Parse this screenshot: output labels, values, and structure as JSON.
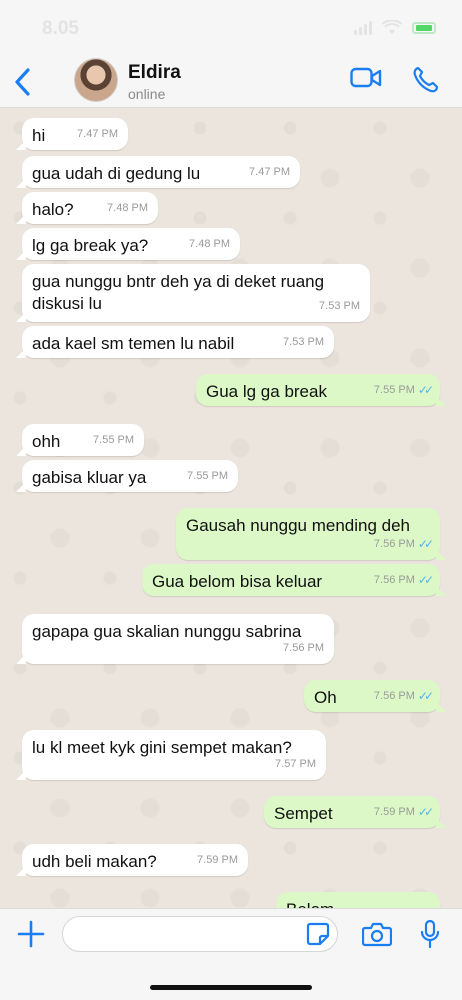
{
  "status_bar": {
    "time": "8.05"
  },
  "header": {
    "name": "Eldira",
    "status": "online"
  },
  "colors": {
    "accent": "#1a7ef2",
    "outgoing_bubble": "#dcf8c6",
    "incoming_bubble": "#ffffff",
    "read_ticks": "#4fb6ec"
  },
  "messages": [
    {
      "dir": "in",
      "text": "hi",
      "time": "7.47 PM"
    },
    {
      "dir": "in",
      "text": "gua udah di gedung lu",
      "time": "7.47 PM"
    },
    {
      "dir": "in",
      "text": "halo?",
      "time": "7.48 PM"
    },
    {
      "dir": "in",
      "text": "lg ga break ya?",
      "time": "7.48 PM"
    },
    {
      "dir": "in",
      "text": "gua nunggu bntr deh ya di deket ruang diskusi lu",
      "time": "7.53 PM"
    },
    {
      "dir": "in",
      "text": "ada kael sm temen lu nabil",
      "time": "7.53 PM"
    },
    {
      "dir": "out",
      "text": "Gua lg ga break",
      "time": "7.55 PM"
    },
    {
      "dir": "in",
      "text": "ohh",
      "time": "7.55 PM"
    },
    {
      "dir": "in",
      "text": "gabisa kluar ya",
      "time": "7.55 PM"
    },
    {
      "dir": "out",
      "text": "Gausah nunggu mending deh",
      "time": "7.56 PM"
    },
    {
      "dir": "out",
      "text": "Gua belom bisa keluar",
      "time": "7.56 PM"
    },
    {
      "dir": "in",
      "text": "gapapa gua skalian nunggu sabrina",
      "time": "7.56 PM"
    },
    {
      "dir": "out",
      "text": "Oh",
      "time": "7.56 PM"
    },
    {
      "dir": "in",
      "text": "lu kl meet kyk gini sempet makan?",
      "time": "7.57 PM"
    },
    {
      "dir": "out",
      "text": "Sempet",
      "time": "7.59 PM"
    },
    {
      "dir": "in",
      "text": "udh beli makan?",
      "time": "7.59 PM"
    },
    {
      "dir": "out",
      "text": "Belom",
      "time": ""
    }
  ],
  "icons": {
    "back": "chevron-left-icon",
    "video": "video-camera-icon",
    "call": "phone-icon",
    "add": "plus-icon",
    "sticker": "sticker-icon",
    "camera": "camera-icon",
    "mic": "microphone-icon"
  }
}
